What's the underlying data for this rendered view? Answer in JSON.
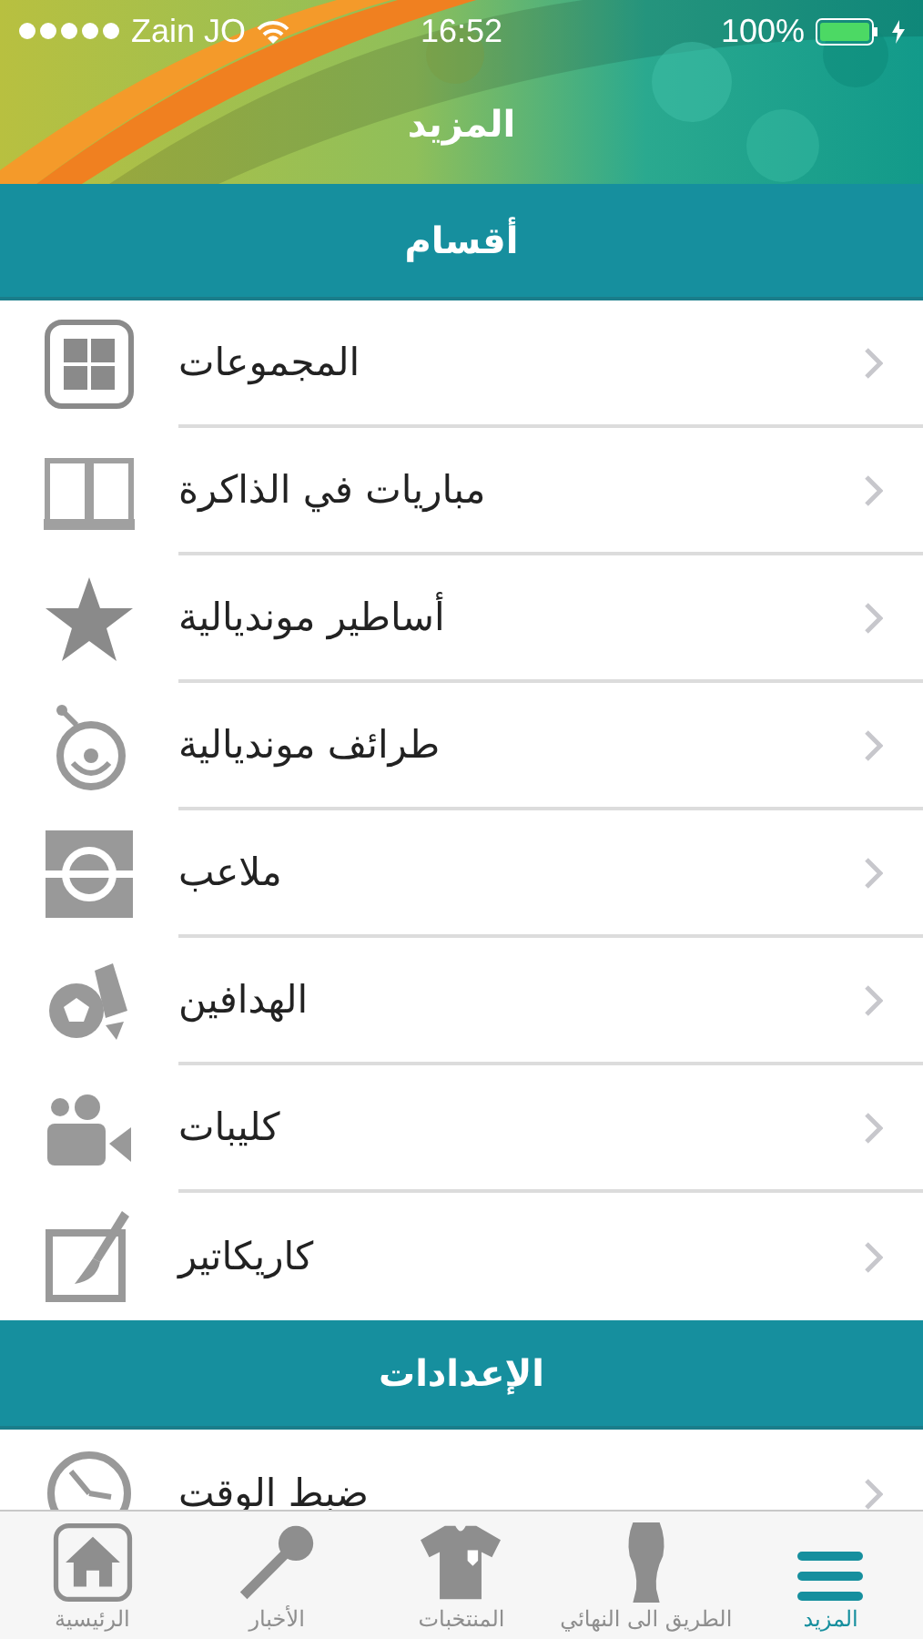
{
  "status_bar": {
    "carrier": "Zain JO",
    "time": "16:52",
    "battery": "100%"
  },
  "nav": {
    "title": "المزيد"
  },
  "sections": [
    {
      "title": "أقسام",
      "items": [
        {
          "label": "المجموعات"
        },
        {
          "label": "مباريات في الذاكرة"
        },
        {
          "label": "أساطير مونديالية"
        },
        {
          "label": "طرائف مونديالية"
        },
        {
          "label": "ملاعب"
        },
        {
          "label": "الهدافين"
        },
        {
          "label": "كليبات"
        },
        {
          "label": "كاريكاتير"
        }
      ]
    },
    {
      "title": "الإعدادات",
      "items": [
        {
          "label": "ضبط الوقت"
        }
      ]
    }
  ],
  "tab_bar": [
    {
      "label": "المزيد",
      "selected": true
    },
    {
      "label": "الطريق الى النهائي",
      "selected": false
    },
    {
      "label": "المنتخبات",
      "selected": false
    },
    {
      "label": "الأخبار",
      "selected": false
    },
    {
      "label": "الرئيسية",
      "selected": false
    }
  ]
}
